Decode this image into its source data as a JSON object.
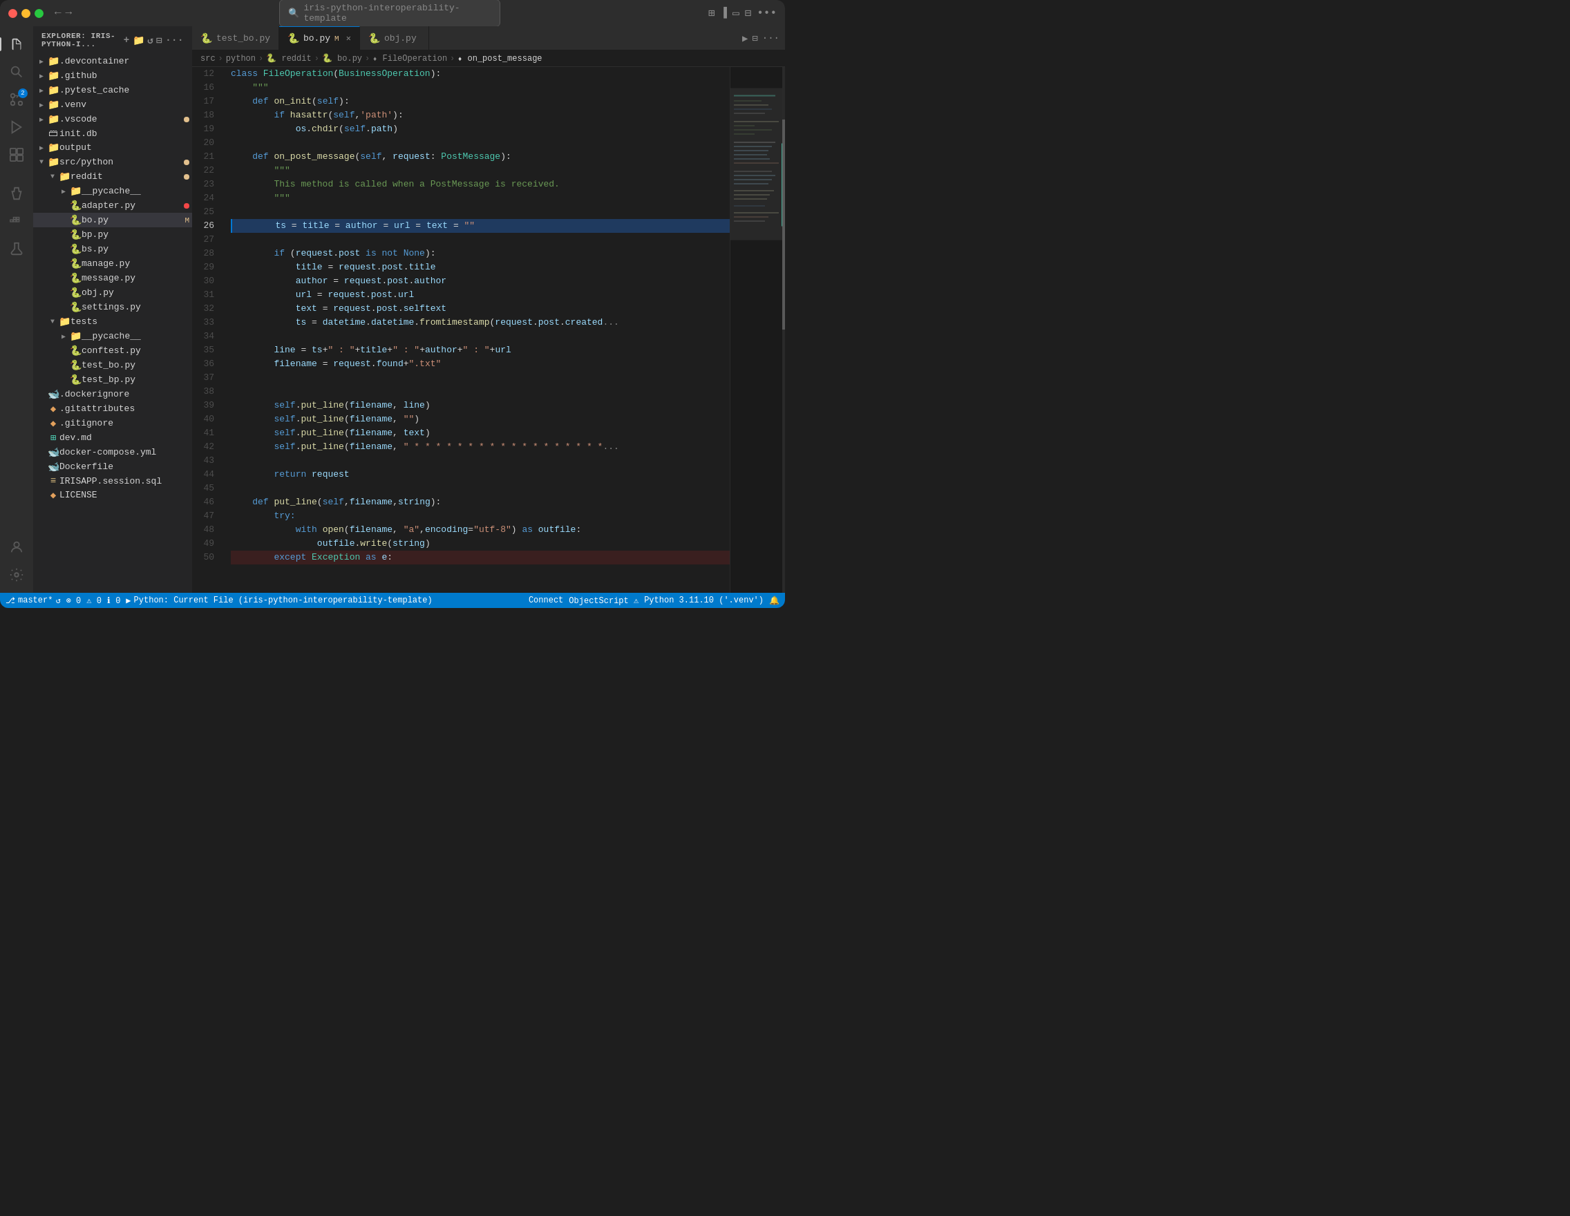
{
  "titlebar": {
    "search_placeholder": "iris-python-interoperability-template",
    "nav_back": "←",
    "nav_forward": "→"
  },
  "tabs": [
    {
      "id": "test_bo",
      "label": "test_bo.py",
      "icon": "🐍",
      "active": false,
      "modified": false
    },
    {
      "id": "bo",
      "label": "bo.py",
      "icon": "🐍",
      "active": true,
      "modified": true,
      "badge": "M"
    },
    {
      "id": "obj",
      "label": "obj.py",
      "icon": "🐍",
      "active": false,
      "modified": false
    }
  ],
  "breadcrumb": {
    "parts": [
      "src",
      "python",
      "reddit",
      "bo.py",
      "FileOperation",
      "on_post_message"
    ]
  },
  "sidebar": {
    "title": "EXPLORER: IRIS-PYTHON-I...",
    "tree": [
      {
        "level": 0,
        "type": "folder",
        "label": ".devcontainer",
        "expanded": false,
        "icon": "📁"
      },
      {
        "level": 0,
        "type": "folder",
        "label": ".github",
        "expanded": false,
        "icon": "📁"
      },
      {
        "level": 0,
        "type": "folder",
        "label": ".pytest_cache",
        "expanded": false,
        "icon": "📁"
      },
      {
        "level": 0,
        "type": "folder",
        "label": ".venv",
        "expanded": false,
        "icon": "📁"
      },
      {
        "level": 0,
        "type": "folder",
        "label": ".vscode",
        "expanded": false,
        "icon": "📁",
        "dot": "modified"
      },
      {
        "level": 0,
        "type": "file",
        "label": "init.db",
        "icon": "🗃"
      },
      {
        "level": 0,
        "type": "folder",
        "label": "output",
        "expanded": false,
        "icon": "📁"
      },
      {
        "level": 0,
        "type": "folder",
        "label": "src/python",
        "expanded": true,
        "icon": "📁",
        "dot": "modified"
      },
      {
        "level": 1,
        "type": "folder",
        "label": "reddit",
        "expanded": true,
        "icon": "📁",
        "dot": "modified"
      },
      {
        "level": 2,
        "type": "folder",
        "label": "__pycache__",
        "expanded": false,
        "icon": "📁"
      },
      {
        "level": 2,
        "type": "file",
        "label": "adapter.py",
        "icon": "🐍",
        "dot": "red"
      },
      {
        "level": 2,
        "type": "file",
        "label": "bo.py",
        "icon": "🐍",
        "active": true,
        "badge": "M"
      },
      {
        "level": 2,
        "type": "file",
        "label": "bp.py",
        "icon": "🐍"
      },
      {
        "level": 2,
        "type": "file",
        "label": "bs.py",
        "icon": "🐍"
      },
      {
        "level": 2,
        "type": "file",
        "label": "manage.py",
        "icon": "🐍"
      },
      {
        "level": 2,
        "type": "file",
        "label": "message.py",
        "icon": "🐍"
      },
      {
        "level": 2,
        "type": "file",
        "label": "obj.py",
        "icon": "🐍"
      },
      {
        "level": 2,
        "type": "file",
        "label": "settings.py",
        "icon": "🐍"
      },
      {
        "level": 1,
        "type": "folder",
        "label": "tests",
        "expanded": true,
        "icon": "📁"
      },
      {
        "level": 2,
        "type": "folder",
        "label": "__pycache__",
        "expanded": false,
        "icon": "📁"
      },
      {
        "level": 2,
        "type": "file",
        "label": "conftest.py",
        "icon": "🐍"
      },
      {
        "level": 2,
        "type": "file",
        "label": "test_bo.py",
        "icon": "🐍"
      },
      {
        "level": 2,
        "type": "file",
        "label": "test_bp.py",
        "icon": "🐍"
      },
      {
        "level": 0,
        "type": "file",
        "label": ".dockerignore",
        "icon": "🐋"
      },
      {
        "level": 0,
        "type": "file",
        "label": ".gitattributes",
        "icon": "🔶"
      },
      {
        "level": 0,
        "type": "file",
        "label": ".gitignore",
        "icon": "🔶"
      },
      {
        "level": 0,
        "type": "file",
        "label": "dev.md",
        "icon": "⊞"
      },
      {
        "level": 0,
        "type": "file",
        "label": "docker-compose.yml",
        "icon": "🐋"
      },
      {
        "level": 0,
        "type": "file",
        "label": "Dockerfile",
        "icon": "🐋"
      },
      {
        "level": 0,
        "type": "file",
        "label": "IRISAPP.session.sql",
        "icon": "≡"
      },
      {
        "level": 0,
        "type": "file",
        "label": "LICENSE",
        "icon": "🔶"
      }
    ]
  },
  "code": {
    "lines": [
      {
        "num": 12,
        "content": "class FileOperation(BusinessOperation):"
      },
      {
        "num": 16,
        "content": "    \"\"\""
      },
      {
        "num": 17,
        "content": "    def on_init(self):"
      },
      {
        "num": 18,
        "content": "        if hasattr(self,'path'):"
      },
      {
        "num": 19,
        "content": "            os.chdir(self.path)"
      },
      {
        "num": 20,
        "content": ""
      },
      {
        "num": 21,
        "content": "    def on_post_message(self, request: PostMessage):"
      },
      {
        "num": 22,
        "content": "        \"\"\""
      },
      {
        "num": 23,
        "content": "        This method is called when a PostMessage is received."
      },
      {
        "num": 24,
        "content": "        \"\"\""
      },
      {
        "num": 25,
        "content": ""
      },
      {
        "num": 26,
        "content": "        ts = title = author = url = text = \"\""
      },
      {
        "num": 27,
        "content": ""
      },
      {
        "num": 28,
        "content": "        if (request.post is not None):"
      },
      {
        "num": 29,
        "content": "            title = request.post.title"
      },
      {
        "num": 30,
        "content": "            author = request.post.author"
      },
      {
        "num": 31,
        "content": "            url = request.post.url"
      },
      {
        "num": 32,
        "content": "            text = request.post.selftext"
      },
      {
        "num": 33,
        "content": "            ts = datetime.datetime.fromtimestamp(request.post.created"
      },
      {
        "num": 34,
        "content": ""
      },
      {
        "num": 35,
        "content": "        line = ts+\" : \"+title+\" : \"+author+\" : \"+url"
      },
      {
        "num": 36,
        "content": "        filename = request.found+\".txt\""
      },
      {
        "num": 37,
        "content": ""
      },
      {
        "num": 38,
        "content": ""
      },
      {
        "num": 39,
        "content": "        self.put_line(filename, line)"
      },
      {
        "num": 40,
        "content": "        self.put_line(filename, \"\")"
      },
      {
        "num": 41,
        "content": "        self.put_line(filename, text)"
      },
      {
        "num": 42,
        "content": "        self.put_line(filename, \" * * * * * * * * * * * * * * * * * *"
      },
      {
        "num": 43,
        "content": ""
      },
      {
        "num": 44,
        "content": "        return request"
      },
      {
        "num": 45,
        "content": ""
      },
      {
        "num": 46,
        "content": "    def put_line(self,filename,string):"
      },
      {
        "num": 47,
        "content": "        try:"
      },
      {
        "num": 48,
        "content": "            with open(filename, \"a\",encoding=\"utf-8\") as outfile:"
      },
      {
        "num": 49,
        "content": "                outfile.write(string)"
      },
      {
        "num": 50,
        "content": "        except Exception as e:"
      }
    ]
  },
  "status_bar": {
    "branch": "master*",
    "sync": "↺",
    "errors": "⊗ 0",
    "warnings": "⚠ 0",
    "info": "ℹ 0",
    "python_task": "Python: Current File (iris-python-interoperability-template)",
    "connect": "Connect",
    "objectscript": "ObjectScript ⚠",
    "python_version": "Python 3.11.10 ('.venv')",
    "notifications": "🔔"
  },
  "activity": {
    "icons": [
      "files",
      "search",
      "source-control",
      "run",
      "extensions",
      "testing",
      "docker",
      "flask",
      "settings"
    ]
  }
}
